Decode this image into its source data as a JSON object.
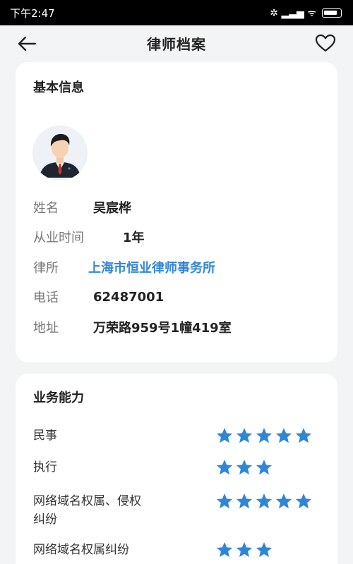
{
  "status_bar": {
    "time": "下午2:47",
    "signal_glyphs": "✲ ▂▃▅ ᯤ"
  },
  "header": {
    "title": "律师档案"
  },
  "basic_info": {
    "title": "基本信息",
    "rows": [
      {
        "label": "姓名",
        "value": "吴宸桦"
      },
      {
        "label": "从业时间",
        "value": "1年"
      },
      {
        "label": "律所",
        "value": "上海市恒业律师事务所"
      },
      {
        "label": "电话",
        "value": "62487001"
      },
      {
        "label": "地址",
        "value": "万荣路959号1幢419室"
      }
    ]
  },
  "skills": {
    "title": "业务能力",
    "items": [
      {
        "name_line1": "民事",
        "name_line2": "",
        "stars": 5
      },
      {
        "name_line1": "执行",
        "name_line2": "",
        "stars": 3
      },
      {
        "name_line1": "网络域名权属、侵权",
        "name_line2": "纠纷",
        "stars": 5
      },
      {
        "name_line1": "网络域名权属纠纷",
        "name_line2": "",
        "stars": 3
      }
    ]
  },
  "colors": {
    "accent_link": "#2f86d8",
    "star": "#2f86d8",
    "background": "#f3f4f6"
  },
  "icons": [
    "back-arrow-icon",
    "heart-outline-icon",
    "avatar-lawyer",
    "star-icon"
  ]
}
